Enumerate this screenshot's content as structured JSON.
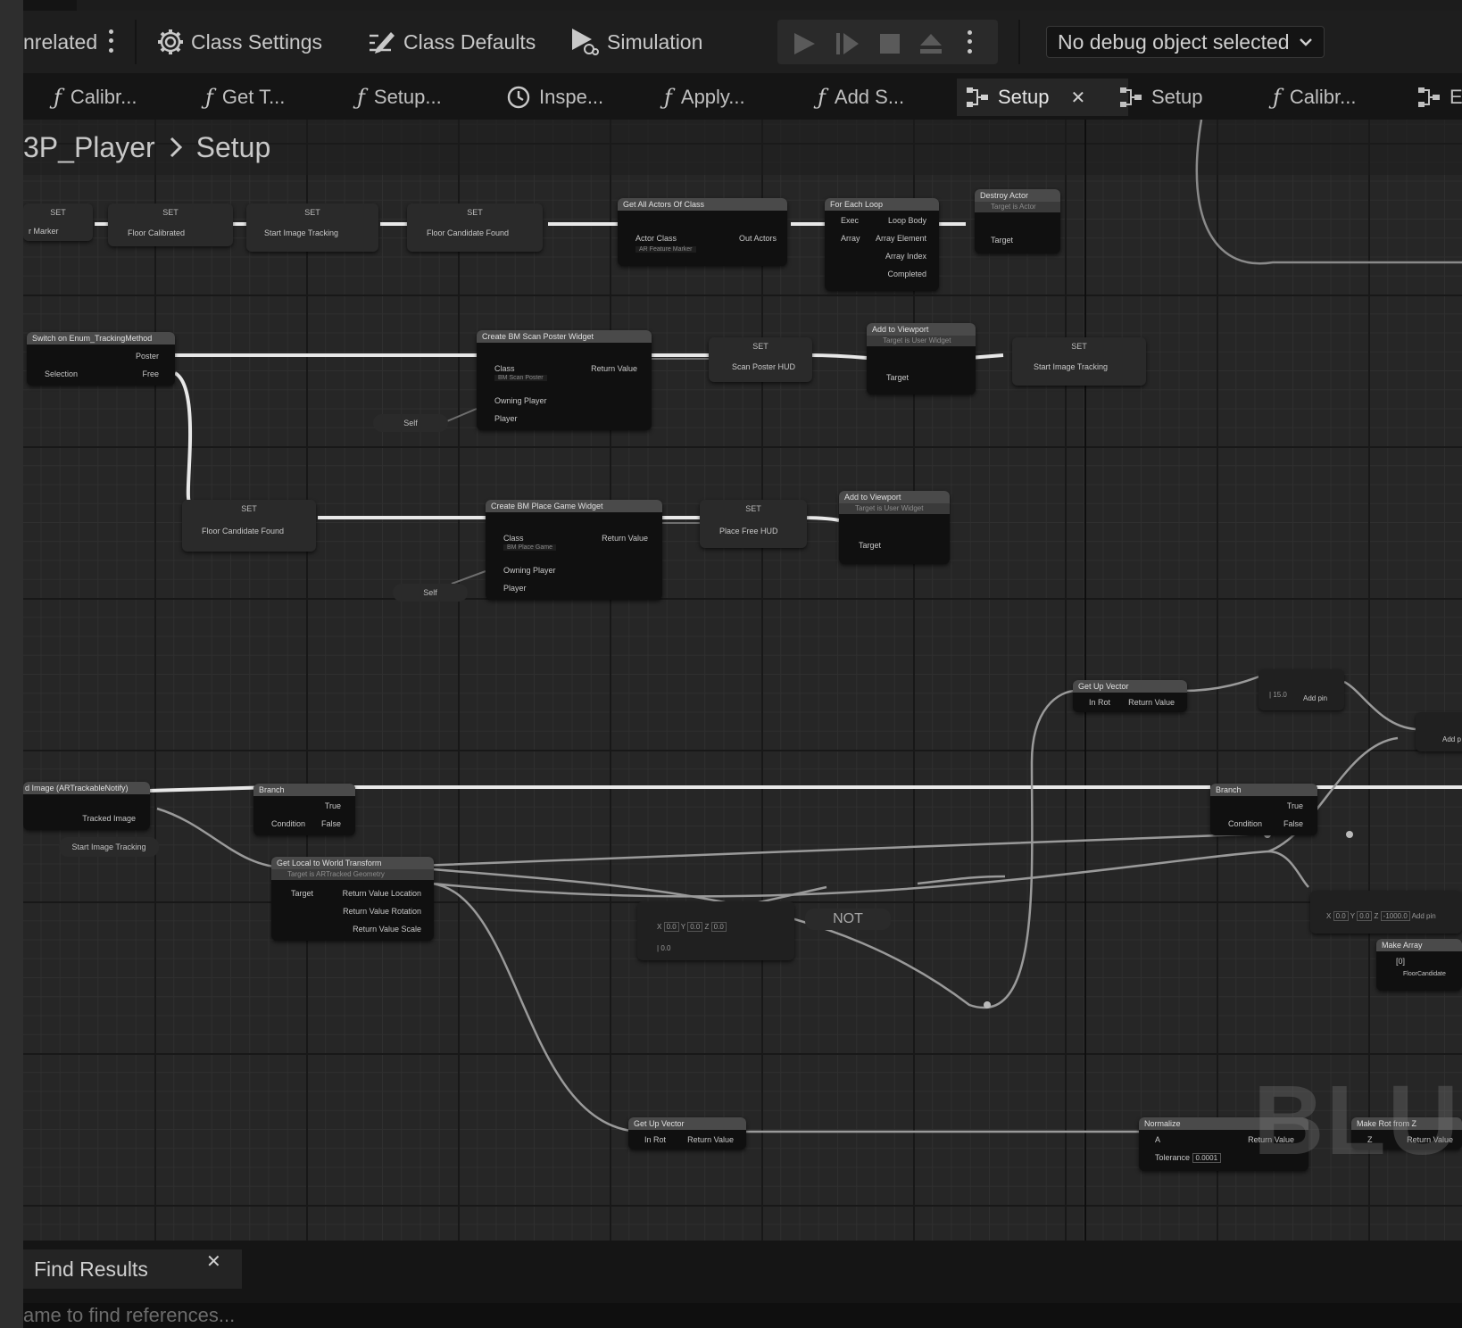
{
  "toolbar": {
    "unrelated_label": "nrelated",
    "class_settings_label": "Class Settings",
    "class_defaults_label": "Class Defaults",
    "simulation_label": "Simulation",
    "debug_selector_value": "No debug object selected"
  },
  "tabs": [
    {
      "label": "Calibr...",
      "icon": "function-icon"
    },
    {
      "label": "Get T...",
      "icon": "function-icon"
    },
    {
      "label": "Setup...",
      "icon": "function-icon"
    },
    {
      "label": "Inspe...",
      "icon": "clock-icon"
    },
    {
      "label": "Apply...",
      "icon": "function-icon"
    },
    {
      "label": "Add S...",
      "icon": "function-icon"
    },
    {
      "label": "Setup",
      "icon": "graph-icon",
      "active": true
    },
    {
      "label": "Setup",
      "icon": "graph-icon"
    },
    {
      "label": "Calibr...",
      "icon": "function-icon"
    },
    {
      "label": "E",
      "icon": "graph-icon"
    }
  ],
  "breadcrumb": {
    "root": "3P_Player",
    "current": "Setup"
  },
  "graph": {
    "watermark": "BLUE",
    "nodes": {
      "set1": {
        "title": "SET",
        "pin": "r Marker"
      },
      "set2": {
        "title": "SET",
        "pin": "Floor Calibrated"
      },
      "set3": {
        "title": "SET",
        "pin": "Start Image Tracking"
      },
      "set4": {
        "title": "SET",
        "pin": "Floor Candidate Found"
      },
      "get_all_actors": {
        "title": "Get All Actors Of Class",
        "in": "Actor Class",
        "out": "Out Actors",
        "value": "AR Feature Marker"
      },
      "for_each": {
        "title": "For Each Loop",
        "in1": "Exec",
        "in2": "Array",
        "out1": "Loop Body",
        "out2": "Array Element",
        "out3": "Array Index",
        "out4": "Completed"
      },
      "destroy_actor": {
        "title": "Destroy Actor",
        "subtitle": "Target is Actor",
        "pin": "Target"
      },
      "switch_enum": {
        "title": "Switch on Enum_TrackingMethod",
        "in": "Selection",
        "out1": "Poster",
        "out2": "Free"
      },
      "create_scan": {
        "title": "Create BM Scan Poster Widget",
        "p1": "Class",
        "p2": "Owning Player",
        "p3": "Player",
        "out": "Return Value",
        "value": "BM Scan Poster"
      },
      "set_scan_hud": {
        "title": "SET",
        "pin": "Scan Poster HUD"
      },
      "add_viewport1": {
        "title": "Add to Viewport",
        "subtitle": "Target is User Widget",
        "pin": "Target"
      },
      "set_start_tracking": {
        "title": "SET",
        "pin": "Start Image Tracking"
      },
      "self1": {
        "label": "Self"
      },
      "set_floor_candidate": {
        "title": "SET",
        "pin": "Floor Candidate Found"
      },
      "create_place": {
        "title": "Create BM Place Game Widget",
        "p1": "Class",
        "p2": "Owning Player",
        "p3": "Player",
        "out": "Return Value",
        "value": "BM Place Game"
      },
      "set_place_hud": {
        "title": "SET",
        "pin": "Place Free HUD"
      },
      "add_viewport2": {
        "title": "Add to Viewport",
        "subtitle": "Target is User Widget",
        "pin": "Target"
      },
      "self2": {
        "label": "Self"
      },
      "event_image": {
        "title": "d Image (ARTrackableNotify)",
        "pin": "Tracked Image"
      },
      "start_tracking_get": {
        "label": "Start Image Tracking"
      },
      "branch1": {
        "title": "Branch",
        "in": "Condition",
        "out1": "True",
        "out2": "False"
      },
      "get_local_world": {
        "title": "Get Local to World Transform",
        "subtitle": "Target is ARTracked Geometry",
        "in": "Target",
        "out1": "Return Value Location",
        "out2": "Return Value Rotation",
        "out3": "Return Value Scale"
      },
      "equal_vec": {
        "x": "0.0",
        "y": "0.0",
        "z": "0.0",
        "tol": "0.0"
      },
      "not_node": {
        "label": "NOT"
      },
      "get_up1": {
        "title": "Get Up Vector",
        "in": "In Rot",
        "out": "Return Value"
      },
      "multiply": {
        "value": "15.0",
        "add": "Add pin"
      },
      "branch2": {
        "title": "Branch",
        "in": "Condition",
        "out1": "True",
        "out2": "False"
      },
      "make_vec": {
        "x": "0.0",
        "y": "0.0",
        "z": "-1000.0",
        "add": "Add pin"
      },
      "make_array": {
        "title": "Make Array",
        "index": "[0]",
        "pin": "FloorCandidate"
      },
      "add_right": {
        "label": "Add p"
      },
      "get_up2": {
        "title": "Get Up Vector",
        "in": "In Rot",
        "out": "Return Value"
      },
      "normalize": {
        "title": "Normalize",
        "in": "A",
        "tol_label": "Tolerance",
        "tol": "0.0001",
        "out": "Return Value"
      },
      "make_rot": {
        "title": "Make Rot from Z",
        "in": "Z",
        "out": "Return Value"
      }
    }
  },
  "bottom": {
    "find_tab_label": "Find Results",
    "find_placeholder": "ame to find references..."
  }
}
